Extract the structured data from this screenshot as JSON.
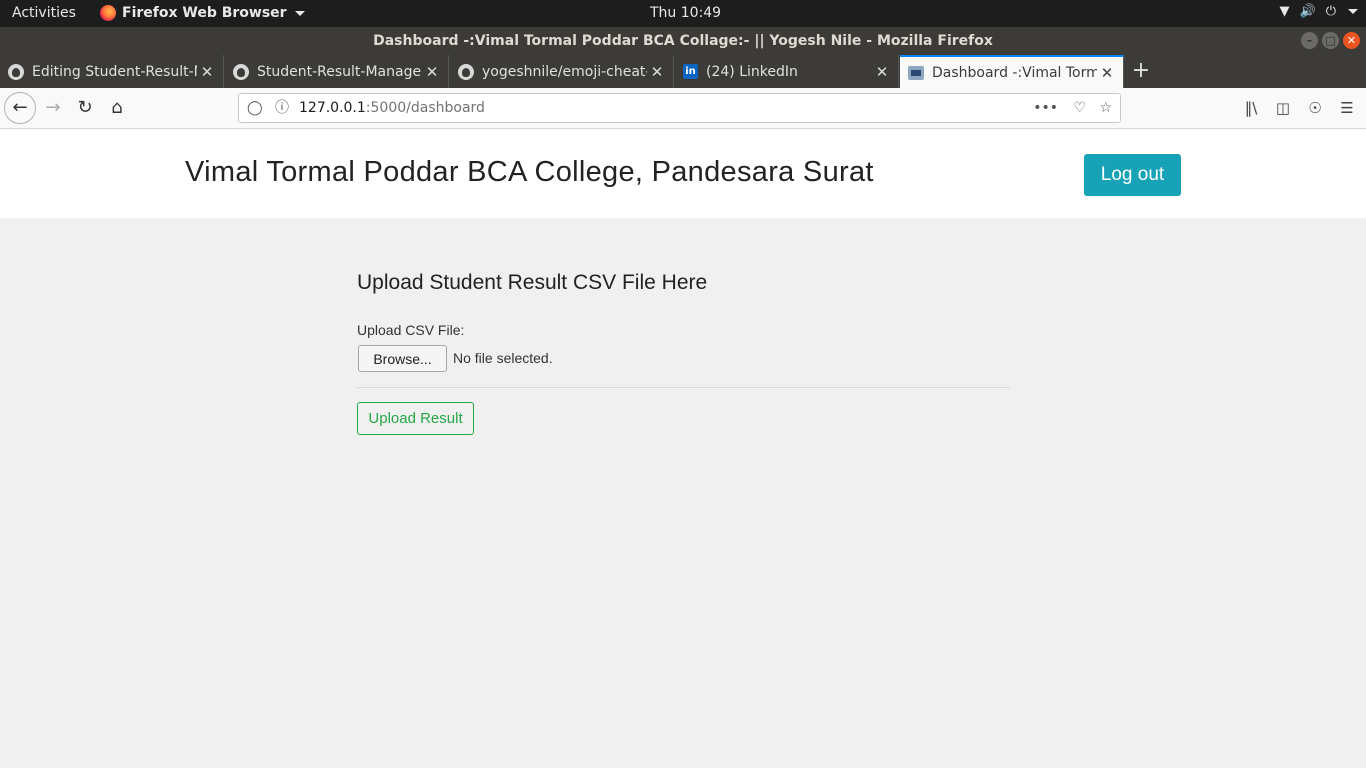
{
  "system_bar": {
    "activities": "Activities",
    "app_name": "Firefox Web Browser",
    "clock": "Thu 10:49"
  },
  "window": {
    "title": "Dashboard -:Vimal Tormal Poddar BCA Collage:- || Yogesh Nile - Mozilla Firefox"
  },
  "tabs": [
    {
      "label": "Editing Student-Result-M",
      "icon": "github-icon"
    },
    {
      "label": "Student-Result-Managem",
      "icon": "github-icon"
    },
    {
      "label": "yogeshnile/emoji-cheat-s",
      "icon": "github-icon"
    },
    {
      "label": "(24) LinkedIn",
      "icon": "linkedin-icon"
    },
    {
      "label": "Dashboard -:Vimal Torma",
      "icon": "page-icon",
      "active": true
    }
  ],
  "address_bar": {
    "host": "127.0.0.1",
    "path": ":5000/dashboard"
  },
  "header": {
    "college_name": "Vimal Tormal Poddar BCA College, Pandesara Surat",
    "logout_label": "Log out"
  },
  "upload_form": {
    "title": "Upload Student Result CSV File Here",
    "file_label": "Upload CSV File:",
    "browse_label": "Browse...",
    "file_status": "No file selected.",
    "submit_label": "Upload Result"
  },
  "colors": {
    "logout_bg": "#17a2b8",
    "upload_accent": "#28a745",
    "page_bg": "#f0f0f0"
  }
}
